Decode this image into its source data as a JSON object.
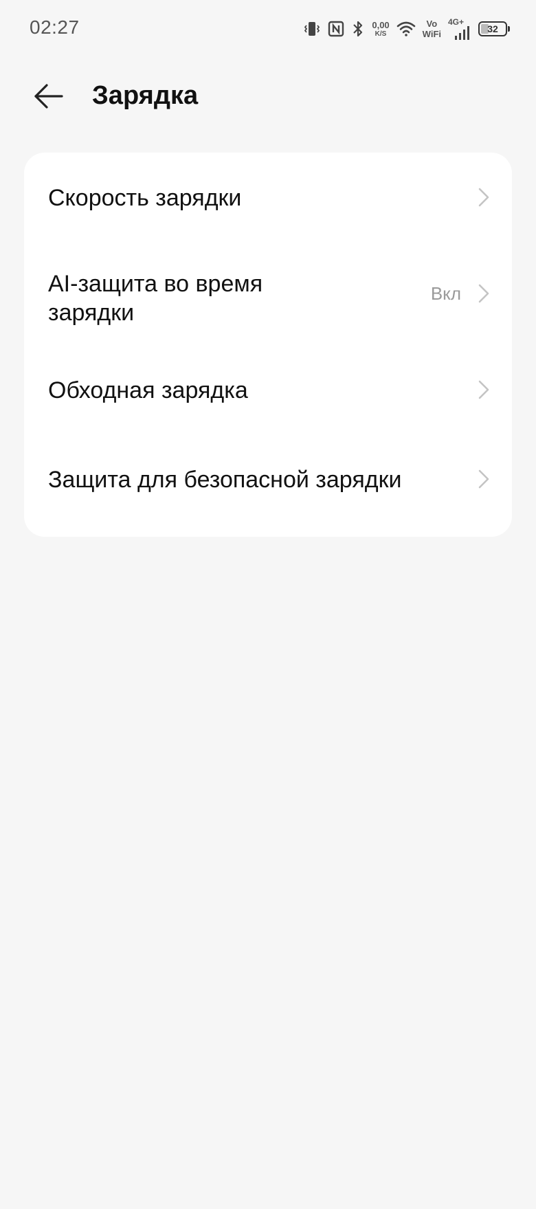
{
  "status_bar": {
    "time": "02:27",
    "net_speed_value": "0,00",
    "net_speed_unit": "K/S",
    "vowifi_top": "Vo",
    "vowifi_bottom": "WiFi",
    "network_type": "4G+",
    "battery_level": "32",
    "battery_fraction": 0.32,
    "icons": [
      "vibrate-icon",
      "nfc-icon",
      "bluetooth-icon",
      "wifi-icon",
      "signal-icon",
      "battery-icon"
    ]
  },
  "header": {
    "title": "Зарядка",
    "back_icon": "arrow-left-icon"
  },
  "settings": {
    "items": [
      {
        "label": "Скорость зарядки",
        "value": ""
      },
      {
        "label": "AI-защита во время зарядки",
        "value": "Вкл"
      },
      {
        "label": "Обходная зарядка",
        "value": ""
      },
      {
        "label": "Защита для безопасной зарядки",
        "value": ""
      }
    ]
  },
  "colors": {
    "background": "#f6f6f6",
    "card": "#ffffff",
    "text_primary": "#111111",
    "text_secondary": "#9a9a9a",
    "chevron": "#c4c4c4"
  }
}
